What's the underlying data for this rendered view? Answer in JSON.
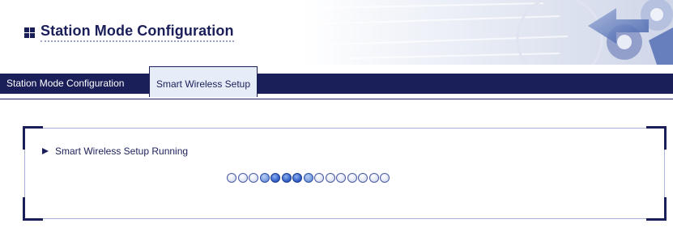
{
  "header": {
    "title": "Station Mode Configuration",
    "icon": "grid-icon",
    "banner_art": "gear-arrows-banner"
  },
  "tabs": [
    {
      "label": "Station Mode Configuration",
      "active": false
    },
    {
      "label": "Smart Wireless Setup",
      "active": true
    }
  ],
  "status": {
    "text": "Smart Wireless Setup Running",
    "icon": "arrow-right-icon",
    "progress_dots": [
      "off",
      "off",
      "off",
      "mid",
      "on",
      "on",
      "on",
      "mid",
      "off",
      "off",
      "off",
      "off",
      "off",
      "off",
      "off"
    ]
  },
  "colors": {
    "navy": "#1a1f5a",
    "tab_active_bg": "#e6edf9",
    "dot_on": "#2f5fc8",
    "frame_line": "#a9b4d8"
  }
}
